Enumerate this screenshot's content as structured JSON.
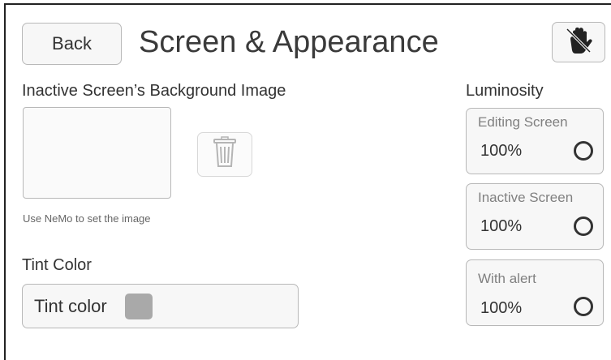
{
  "header": {
    "back_label": "Back",
    "title": "Screen & Appearance",
    "mute_icon": "hand-mute-icon"
  },
  "background_image": {
    "heading": "Inactive Screen’s Background Image",
    "hint": "Use NeMo to set the image",
    "delete_icon": "trash-icon"
  },
  "tint": {
    "heading": "Tint Color",
    "field_label": "Tint color",
    "swatch_color": "#a9a9a9"
  },
  "luminosity": {
    "heading": "Luminosity",
    "items": [
      {
        "label": "Editing Screen",
        "value": "100%"
      },
      {
        "label": "Inactive Screen",
        "value": "100%"
      },
      {
        "label": "With alert",
        "value": "100%"
      }
    ]
  }
}
